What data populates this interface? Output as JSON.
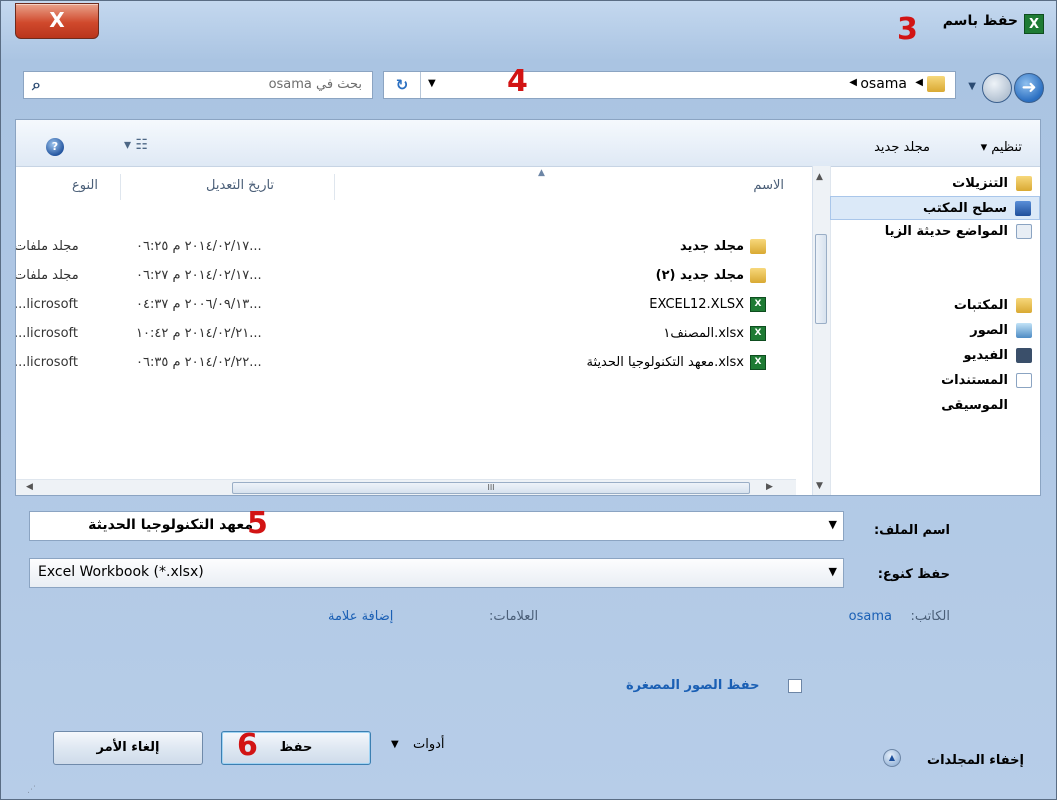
{
  "window": {
    "title": "حفظ باسم",
    "close_label": "X"
  },
  "annotations": {
    "n3": "3",
    "n4": "4",
    "n5": "5",
    "n6": "6"
  },
  "address": {
    "path": "osama",
    "back_icon": "back-arrow-icon",
    "forward_icon": "forward-arrow-icon"
  },
  "search": {
    "placeholder": "بحث في osama"
  },
  "toolbar": {
    "organize": "تنظيم ▾",
    "new_folder": "مجلد جديد"
  },
  "nav": {
    "items": [
      {
        "label": "التنزيلات",
        "icon": "downloads-folder-icon"
      },
      {
        "label": "سطح المكتب",
        "icon": "desktop-icon"
      },
      {
        "label": "المواضع حديثة الزيا",
        "icon": "recent-places-icon"
      },
      {
        "label": "المكتبات",
        "icon": "libraries-icon"
      },
      {
        "label": "الصور",
        "icon": "pictures-icon"
      },
      {
        "label": "الفيديو",
        "icon": "videos-icon"
      },
      {
        "label": "المستندات",
        "icon": "documents-icon"
      },
      {
        "label": "الموسيقى",
        "icon": "music-icon"
      }
    ]
  },
  "files": {
    "columns": {
      "name": "الاسم",
      "date": "تاريخ التعديل",
      "type": "النوع"
    },
    "rows": [
      {
        "name": "مجلد جديد",
        "date": "٢٠١٤/٠٢/١٧ م ٠٦:٢٥...",
        "type": "مجلد ملفات",
        "kind": "folder"
      },
      {
        "name": "مجلد جديد (٢)",
        "date": "٢٠١٤/٠٢/١٧ م ٠٦:٢٧...",
        "type": "مجلد ملفات",
        "kind": "folder"
      },
      {
        "name": "EXCEL12.XLSX",
        "date": "٢٠٠٦/٠٩/١٣ م ٠٤:٣٧...",
        "type": "licrosoft...",
        "kind": "xlsx"
      },
      {
        "name": "xlsx.المصنف١",
        "date": "٢٠١٤/٠٢/٢١ م ١٠:٤٢...",
        "type": "licrosoft...",
        "kind": "xlsx"
      },
      {
        "name": "xlsx.معهد التكنولوجيا الحديثة",
        "date": "٢٠١٤/٠٢/٢٢ م ٠٦:٣٥...",
        "type": "licrosoft...",
        "kind": "xlsx"
      }
    ]
  },
  "form": {
    "filename_label": "اسم الملف:",
    "filename_value": "معهد التكنولوجيا الحديثة",
    "savetype_label": "حفظ كنوع:",
    "savetype_value": "Excel Workbook (*.xlsx)",
    "author_label": "الكاتب:",
    "author_value": "osama",
    "tags_label": "العلامات:",
    "tags_value": "إضافة علامة",
    "thumbnail_label": "حفظ الصور المصغرة",
    "thumbnail_checked": false
  },
  "buttons": {
    "tools": "أدوات",
    "save": "حفظ",
    "cancel": "إلغاء الأمر",
    "hide_folders": "إخفاء المجلدات"
  }
}
